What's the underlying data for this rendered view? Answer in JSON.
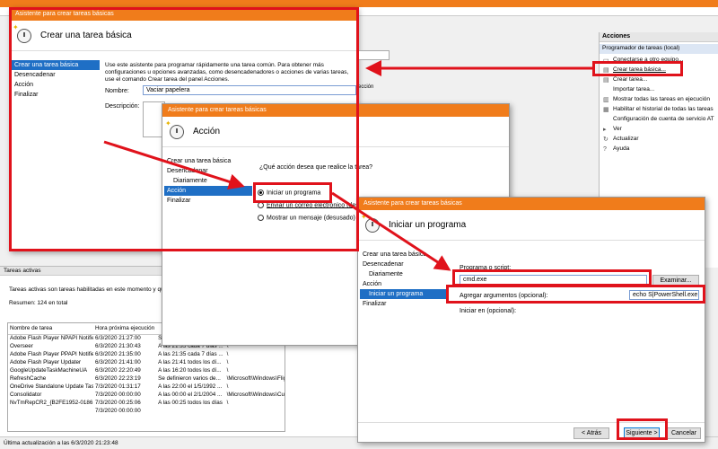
{
  "topbar": {
    "accent": "#f07c1b"
  },
  "actions_panel": {
    "header": "Acciones",
    "section": "Programador de tareas (local)",
    "items": [
      {
        "label": "Conectarse a otro equipo...",
        "icon": "computer-icon"
      },
      {
        "label": "Crear tarea básica...",
        "icon": "task-icon"
      },
      {
        "label": "Crear tarea...",
        "icon": "task-icon"
      },
      {
        "label": "Importar tarea...",
        "icon": "blank"
      },
      {
        "label": "Mostrar todas las tareas en ejecución",
        "icon": "list-icon"
      },
      {
        "label": "Habilitar el historial de todas las tareas",
        "icon": "history-icon"
      },
      {
        "label": "Configuración de cuenta de servicio AT",
        "icon": "blank"
      },
      {
        "label": "Ver",
        "icon": "view-icon"
      },
      {
        "label": "Actualizar",
        "icon": "refresh-icon"
      },
      {
        "label": "Ayuda",
        "icon": "help-icon"
      }
    ]
  },
  "tasks_panel": {
    "title": "Tareas activas",
    "description": "Tareas activas son tareas habilitadas en este momento y que no",
    "summary": "Resumen: 124 en total",
    "columns": [
      "Nombre de tarea",
      "Hora próxima ejecución",
      "",
      ""
    ],
    "rows": [
      [
        "Adobe Flash Player NPAPI Notifier",
        "6/3/2020 21:27:00",
        "Se definieron varios de...",
        "\\Macromedia\\..."
      ],
      [
        "Overseer",
        "6/3/2020 21:30:43",
        "A las 21:35 cada 7 días ...",
        "\\"
      ],
      [
        "Adobe Flash Player PPAPI Notifier",
        "6/3/2020 21:35:00",
        "A las 21:35 cada 7 días ...",
        "\\"
      ],
      [
        "Adobe Flash Player Updater",
        "6/3/2020 21:41:00",
        "A las 21:41 todos los dí...",
        "\\"
      ],
      [
        "GoogleUpdateTaskMachineUA",
        "6/3/2020 22:20:49",
        "A las 16:20 todos los dí...",
        "\\"
      ],
      [
        "RefreshCache",
        "6/3/2020 22:23:19",
        "Se definieron varios de...",
        "\\Microsoft\\Windows\\Flig..."
      ],
      [
        "OneDrive Standalone Update Tas...",
        "7/3/2020 01:31:17",
        "A las 22:00 el 1/5/1992 ...",
        "\\"
      ],
      [
        "Consolidator",
        "7/3/2020 00:00:00",
        "A las 00:00 el 2/1/2004 ...",
        "\\Microsoft\\Windows\\Cu..."
      ],
      [
        "NvTmRepCR2_{B2FE1952-0186...",
        "7/3/2020 00:25:06",
        "A las 00:25 todos los días",
        "\\"
      ],
      [
        "",
        "7/3/2020 00:00:00",
        "",
        ""
      ]
    ],
    "status": "Última actualización a las 6/3/2020 21:23:48"
  },
  "wizard1": {
    "titlebar": "Asistente para crear tareas básicas",
    "heading": "Crear una tarea básica",
    "steps": [
      "Crear una tarea básica",
      "Desencadenar",
      "Acción",
      "Finalizar"
    ],
    "intro": "Use este asistente para programar rápidamente una tarea común. Para obtener más configuraciones u opciones avanzadas, como desencadenadores o acciones de varias tareas, use el comando Crear tarea del panel Acciones.",
    "name_label": "Nombre:",
    "name_value": "Vaciar papelera",
    "desc_label": "Descripción:",
    "behind_text": "ección",
    "behind_tab": "Ini",
    "behind_tab2": "Es"
  },
  "wizard2": {
    "titlebar": "Asistente para crear tareas básicas",
    "heading": "Acción",
    "steps": [
      "Crear una tarea básica",
      "Desencadenar",
      "Diariamente",
      "Acción",
      "Finalizar"
    ],
    "question": "¿Qué acción desea que realice la tarea?",
    "options": [
      "Iniciar un programa",
      "Enviar un correo electrónico (desu",
      "Mostrar un mensaje (desusado)"
    ]
  },
  "wizard3": {
    "titlebar": "Asistente para crear tareas básicas",
    "heading": "Iniciar un programa",
    "steps": [
      "Crear una tarea básica",
      "Desencadenar",
      "Diariamente",
      "Acción",
      "Iniciar un programa",
      "Finalizar"
    ],
    "script_label": "Programa o script:",
    "script_value": "cmd.exe",
    "browse_label": "Examinar...",
    "args_label": "Agregar argumentos (opcional):",
    "args_value": "echo S|PowerShell.exe -",
    "start_label": "Iniciar en (opcional):",
    "back_label": "< Atrás",
    "next_label": "Siguiente >",
    "cancel_label": "Cancelar"
  },
  "highlight_color": "#e0121b"
}
